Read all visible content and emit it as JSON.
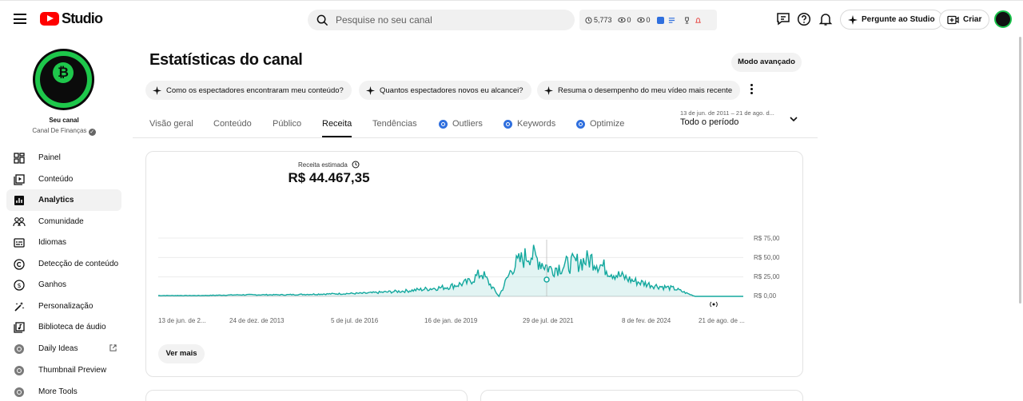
{
  "header": {
    "logo_text": "Studio",
    "search_placeholder": "Pesquise no seu canal",
    "stats": {
      "views": "5,773",
      "a": "0",
      "b": "0"
    },
    "ask_studio_label": "Pergunte ao Studio",
    "create_label": "Criar"
  },
  "channel": {
    "name": "Seu canal",
    "subtitle": "Canal De Finanças"
  },
  "sidebar": {
    "items": [
      {
        "label": "Painel",
        "icon": "dashboard-icon"
      },
      {
        "label": "Conteúdo",
        "icon": "content-icon"
      },
      {
        "label": "Analytics",
        "icon": "analytics-icon",
        "active": true
      },
      {
        "label": "Comunidade",
        "icon": "community-icon"
      },
      {
        "label": "Idiomas",
        "icon": "subtitles-icon"
      },
      {
        "label": "Detecção de conteúdo",
        "icon": "copyright-icon"
      },
      {
        "label": "Ganhos",
        "icon": "earn-icon"
      },
      {
        "label": "Personalização",
        "icon": "customization-icon"
      },
      {
        "label": "Biblioteca de áudio",
        "icon": "audio-library-icon"
      },
      {
        "label": "Daily Ideas",
        "icon": "extension-icon",
        "external": true
      },
      {
        "label": "Thumbnail Preview",
        "icon": "extension-icon"
      },
      {
        "label": "More Tools",
        "icon": "extension-icon"
      }
    ]
  },
  "main": {
    "title": "Estatísticas do canal",
    "advanced_mode": "Modo avançado",
    "chips": [
      "Como os espectadores encontraram meu conteúdo?",
      "Quantos espectadores novos eu alcancei?",
      "Resuma o desempenho do meu vídeo mais recente"
    ],
    "tabs": [
      {
        "label": "Visão geral"
      },
      {
        "label": "Conteúdo"
      },
      {
        "label": "Público"
      },
      {
        "label": "Receita",
        "active": true
      },
      {
        "label": "Tendências"
      },
      {
        "label": "Outliers",
        "ext": true
      },
      {
        "label": "Keywords",
        "ext": true
      },
      {
        "label": "Optimize",
        "ext": true
      }
    ],
    "period": {
      "range": "13 de jun. de 2011 – 21 de ago. d...",
      "label": "Todo o período"
    },
    "metric": {
      "label": "Receita estimada",
      "value": "R$ 44.467,35"
    },
    "see_more": "Ver mais"
  },
  "colors": {
    "accent": "#13a89e",
    "youtube_red": "#ff0000",
    "ext_blue": "#2f6fde",
    "brand_green": "#1ec74b"
  },
  "chart_data": {
    "type": "area",
    "ylabels": [
      "R$ 75,00",
      "R$ 50,00",
      "R$ 25,00",
      "R$ 0,00"
    ],
    "ylim": [
      0,
      75
    ],
    "xlabels": [
      "13 de jun. de 2...",
      "24 de dez. de 2013",
      "5 de jul. de 2016",
      "16 de jan. de 2019",
      "29 de jul. de 2021",
      "8 de fev. de 2024",
      "21 de ago. de ..."
    ],
    "x": [
      "2011-06",
      "2012-06",
      "2013-06",
      "2014-06",
      "2015-06",
      "2016-06",
      "2017-06",
      "2018-06",
      "2018-12",
      "2019-04",
      "2019-09",
      "2020-01",
      "2020-06",
      "2020-12",
      "2021-06",
      "2021-12",
      "2022-06",
      "2022-12",
      "2023-06",
      "2023-12",
      "2024-06",
      "2025-08"
    ],
    "values": [
      1,
      1,
      2,
      2,
      3,
      4,
      7,
      12,
      18,
      30,
      0,
      38,
      55,
      35,
      42,
      48,
      30,
      20,
      14,
      10,
      0,
      0
    ],
    "series_color": "#13a89e"
  }
}
